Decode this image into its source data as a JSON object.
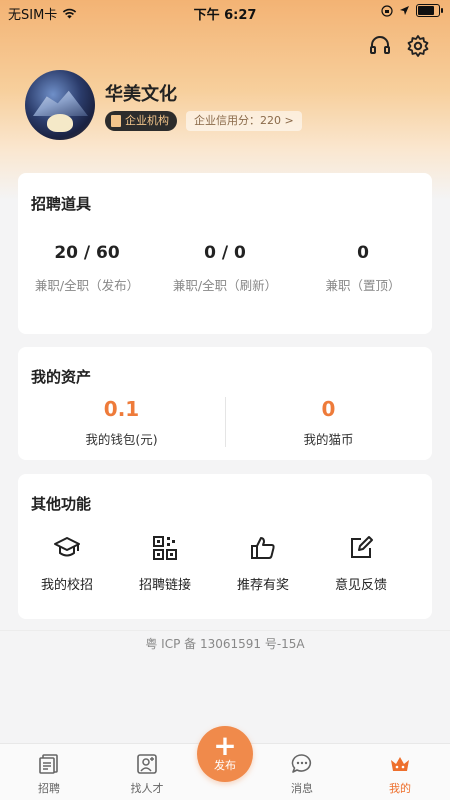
{
  "status_bar": {
    "carrier": "无SIM卡",
    "time": "下午 6:27"
  },
  "profile": {
    "company_name": "华美文化",
    "org_badge": "企业机构",
    "credit_score": "企业信用分：220 >"
  },
  "recruit_tools": {
    "title": "招聘道具",
    "items": [
      {
        "value": "20 / 60",
        "label": "兼职/全职（发布）"
      },
      {
        "value": "0 / 0",
        "label": "兼职/全职（刷新）"
      },
      {
        "value": "0",
        "label": "兼职（置顶）"
      }
    ]
  },
  "assets": {
    "title": "我的资产",
    "wallet": {
      "value": "0.1",
      "label": "我的钱包(元)"
    },
    "coins": {
      "value": "0",
      "label": "我的猫币"
    }
  },
  "other_features": {
    "title": "其他功能",
    "items": [
      {
        "label": "我的校招",
        "icon": "graduation-cap-icon"
      },
      {
        "label": "招聘链接",
        "icon": "qr-code-icon"
      },
      {
        "label": "推荐有奖",
        "icon": "thumbs-up-icon"
      },
      {
        "label": "意见反馈",
        "icon": "edit-icon"
      }
    ]
  },
  "icp": "粤 ICP 备 13061591 号-15A",
  "tabbar": {
    "items": [
      {
        "label": "招聘",
        "icon": "recruit-icon"
      },
      {
        "label": "找人才",
        "icon": "find-talent-icon"
      },
      {
        "label": "发布",
        "icon": "plus-icon"
      },
      {
        "label": "消息",
        "icon": "message-icon"
      },
      {
        "label": "我的",
        "icon": "crown-icon"
      }
    ],
    "active": "我的"
  },
  "colors": {
    "accent": "#ee7b3a",
    "header_gradient_top": "#f3b374"
  }
}
